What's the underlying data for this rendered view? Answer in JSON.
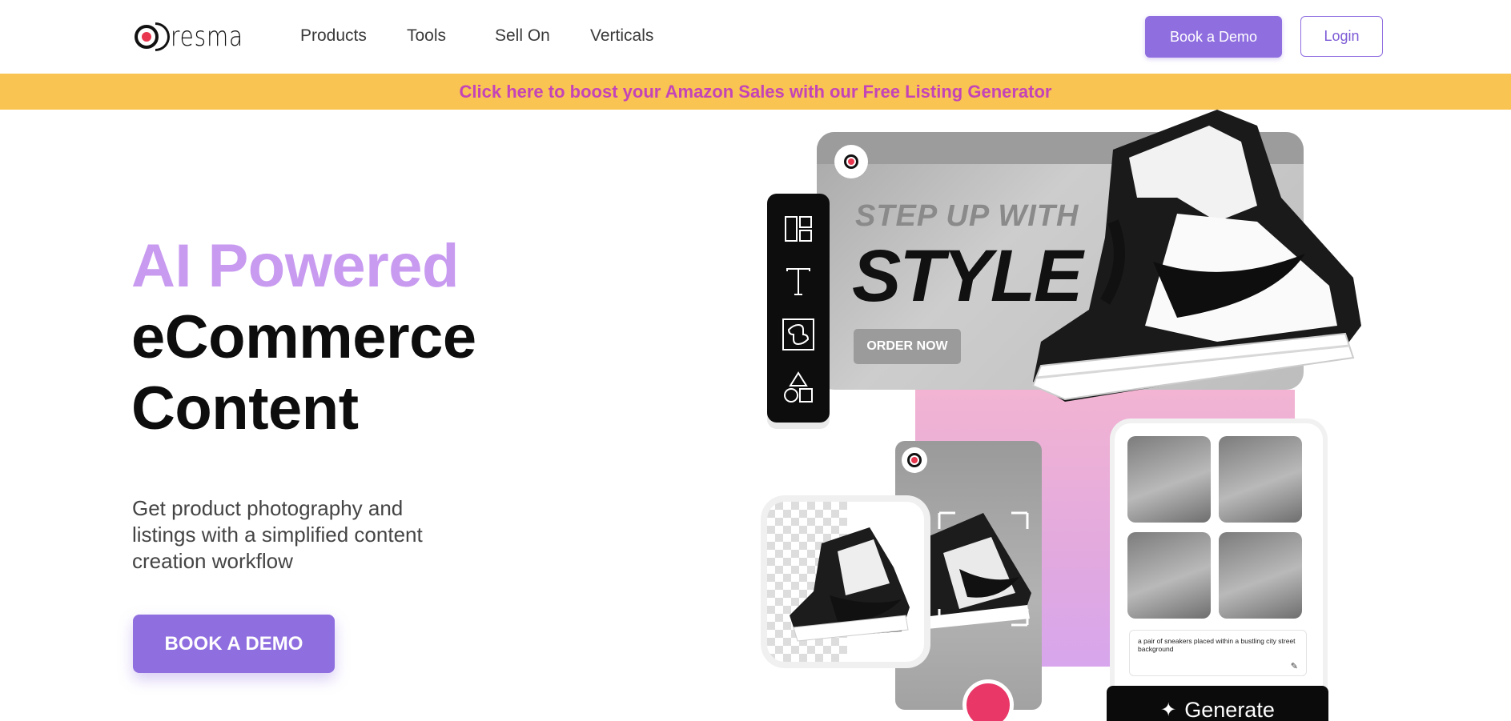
{
  "brand": {
    "logo_text": "resma"
  },
  "nav": {
    "items": [
      "Products",
      "Tools",
      "Sell On",
      "Verticals"
    ],
    "book_demo": "Book a Demo",
    "login": "Login"
  },
  "promo": {
    "text": "Click here to boost your Amazon Sales with our Free Listing Generator"
  },
  "hero": {
    "title_line1": "AI Powered",
    "title_line2": "eCommerce",
    "title_line3": "Content",
    "subtitle": "Get product photography and listings with a simplified content creation workflow",
    "cta": "BOOK A DEMO"
  },
  "illustration": {
    "banner_small": "STEP UP WITH",
    "banner_big": "STYLE",
    "banner_button": "ORDER NOW",
    "prompt_text": "a pair of sneakers placed within a bustling city street background",
    "generate_label": "Generate",
    "tools": [
      "layout-icon",
      "text-icon",
      "plugin-icon",
      "shapes-icon"
    ]
  },
  "colors": {
    "accent_purple": "#8f6ee0",
    "title_lavender": "#c89bf0",
    "promo_bg": "#f9c452",
    "promo_text": "#c444b8",
    "record_pink": "#e93768"
  }
}
